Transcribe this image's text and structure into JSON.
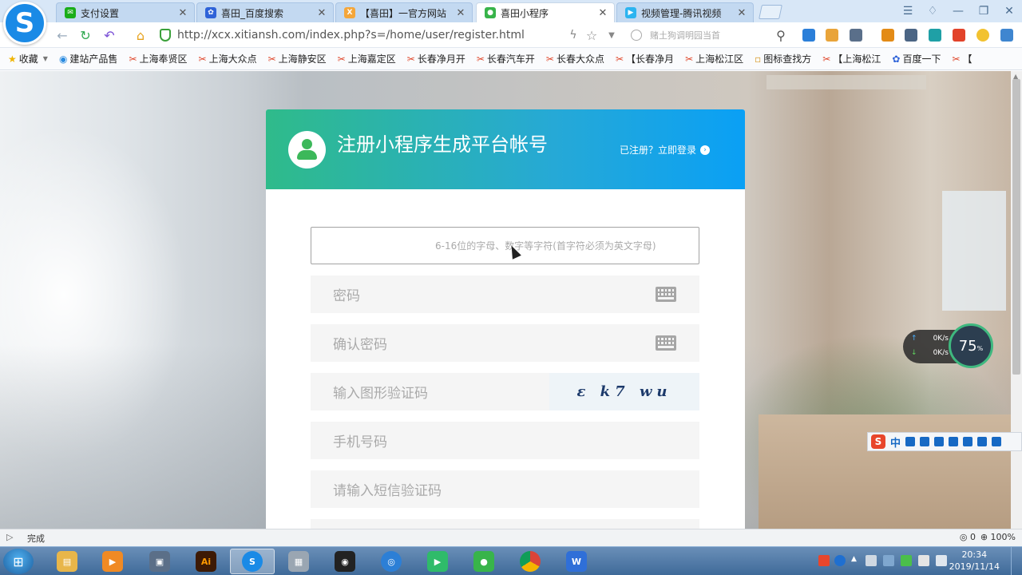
{
  "tabs": [
    {
      "label": "支付设置",
      "icon": "chat-icon",
      "color": "#1aad19",
      "active": false
    },
    {
      "label": "喜田_百度搜索",
      "icon": "baidu-paw-icon",
      "color": "#2f63d8",
      "active": false
    },
    {
      "label": "【喜田】一官方网站",
      "icon": "x-site-icon",
      "color": "#f4a63a",
      "active": false
    },
    {
      "label": "喜田小程序",
      "icon": "wechat-icon",
      "color": "#38b44a",
      "active": true
    },
    {
      "label": "视频管理-腾讯视频",
      "icon": "video-icon",
      "color": "#2cb4f0",
      "active": false
    }
  ],
  "address": {
    "url": "http://xcx.xitiansh.com/index.php?s=/home/user/register.html",
    "search_placeholder": "赌土狗调明园当首"
  },
  "bookmarks": [
    {
      "label": "收藏",
      "icon": "star-icon"
    },
    {
      "label": "建站产品售",
      "icon": "globe-icon"
    },
    {
      "label": "上海奉贤区",
      "icon": "scissors-icon"
    },
    {
      "label": "上海大众点",
      "icon": "scissors-icon"
    },
    {
      "label": "上海静安区",
      "icon": "scissors-icon"
    },
    {
      "label": "上海嘉定区",
      "icon": "scissors-icon"
    },
    {
      "label": "长春净月开",
      "icon": "scissors-icon"
    },
    {
      "label": "长春汽车开",
      "icon": "scissors-icon"
    },
    {
      "label": "长春大众点",
      "icon": "scissors-icon"
    },
    {
      "label": "【长春净月",
      "icon": "scissors-icon"
    },
    {
      "label": "上海松江区",
      "icon": "scissors-icon"
    },
    {
      "label": "图标查找方",
      "icon": "page-icon"
    },
    {
      "label": "【上海松江",
      "icon": "scissors-icon"
    },
    {
      "label": "百度一下",
      "icon": "baidu-paw-icon"
    },
    {
      "label": "【",
      "icon": "scissors-icon"
    }
  ],
  "card": {
    "title": "注册小程序生成平台帐号",
    "login_link": "已注册？立即登录",
    "fields": {
      "username": "6-16位的字母、数字等字符(首字符必须为英文字母)",
      "password": "密码",
      "confirm": "确认密码",
      "captcha": "输入图形验证码",
      "captcha_text": "ɛ k7 wu",
      "phone": "手机号码",
      "sms": "请输入短信验证码"
    }
  },
  "widget": {
    "upload": "0K/s",
    "download": "0K/s",
    "percent": "75",
    "percent_unit": "%"
  },
  "ime": {
    "lang": "中"
  },
  "status": {
    "text": "完成",
    "zoom": "100%",
    "counter": "0"
  },
  "taskbar": {
    "time": "20:34",
    "date": "2019/11/14",
    "apps": [
      "file-explorer-icon",
      "media-player-icon",
      "screen-capture-icon",
      "illustrator-icon",
      "sogou-browser-icon",
      "virtual-machine-icon",
      "screen-recorder-icon",
      "qq-browser-icon",
      "video-player-icon",
      "wechat-icon",
      "chrome-icon",
      "wps-writer-icon"
    ]
  }
}
